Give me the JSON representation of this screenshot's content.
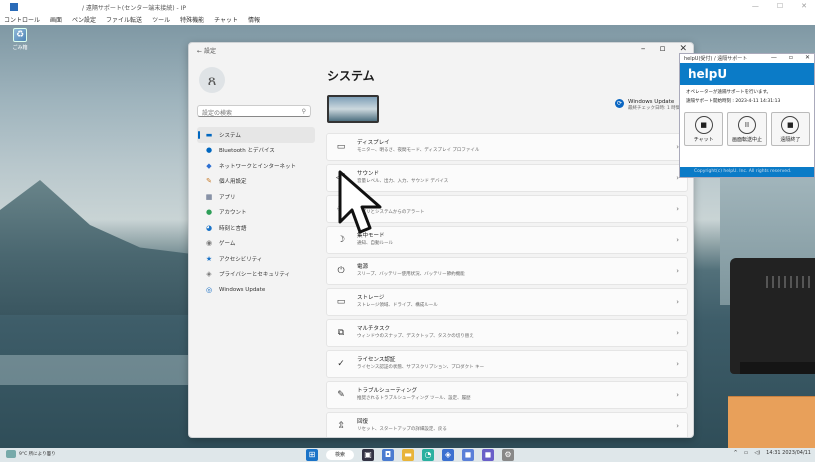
{
  "remote_window": {
    "title": "/ 遠隔サポート(センター端末接続) - IP",
    "menu": [
      "コントロール",
      "画面",
      "ペン設定",
      "ファイル転送",
      "ツール",
      "特殊機能",
      "チャット",
      "情報"
    ]
  },
  "desktop": {
    "icon_label": "ごみ箱"
  },
  "settings": {
    "back_label": "設定",
    "search_placeholder": "設定の検索",
    "page_title": "システム",
    "windows_update": {
      "title": "Windows Update",
      "subtitle": "最終チェック日時: 1 時間前"
    },
    "nav": [
      {
        "icon": "system-icon",
        "glyph": "▬",
        "label": "システム",
        "color": "#0067c0",
        "selected": true
      },
      {
        "icon": "bluetooth-icon",
        "glyph": "●",
        "label": "Bluetooth とデバイス",
        "color": "#0067c0"
      },
      {
        "icon": "network-icon",
        "glyph": "◆",
        "label": "ネットワークとインターネット",
        "color": "#2d6fd1"
      },
      {
        "icon": "personalization-icon",
        "glyph": "✎",
        "label": "個人用設定",
        "color": "#c77b2a"
      },
      {
        "icon": "apps-icon",
        "glyph": "▦",
        "label": "アプリ",
        "color": "#4a5a7a"
      },
      {
        "icon": "accounts-icon",
        "glyph": "●",
        "label": "アカウント",
        "color": "#2e9e58"
      },
      {
        "icon": "time-language-icon",
        "glyph": "◕",
        "label": "時刻と言語",
        "color": "#1a73c8"
      },
      {
        "icon": "gaming-icon",
        "glyph": "◉",
        "label": "ゲーム",
        "color": "#777"
      },
      {
        "icon": "accessibility-icon",
        "glyph": "★",
        "label": "アクセシビリティ",
        "color": "#1a73c8"
      },
      {
        "icon": "privacy-icon",
        "glyph": "◈",
        "label": "プライバシーとセキュリティ",
        "color": "#777"
      },
      {
        "icon": "windows-update-icon",
        "glyph": "◎",
        "label": "Windows Update",
        "color": "#0a66c2"
      }
    ],
    "cards": [
      {
        "icon": "display-icon",
        "glyph": "▭",
        "title": "ディスプレイ",
        "sub": "モニター、明るさ、夜間モード、ディスプレイ プロファイル"
      },
      {
        "icon": "sound-icon",
        "glyph": "◁)",
        "title": "サウンド",
        "sub": "音量レベル、出力、入力、サウンド デバイス"
      },
      {
        "icon": "notifications-icon",
        "glyph": "◌",
        "title": "通知",
        "sub": "アプリとシステムからのアラート"
      },
      {
        "icon": "focus-icon",
        "glyph": "☽",
        "title": "集中モード",
        "sub": "通知、自動ルール"
      },
      {
        "icon": "power-icon",
        "glyph": "⏻",
        "title": "電源",
        "sub": "スリープ、バッテリー使用状況、バッテリー節約機能"
      },
      {
        "icon": "storage-icon",
        "glyph": "▭",
        "title": "ストレージ",
        "sub": "ストレージ領域、ドライブ、構成ルール"
      },
      {
        "icon": "multitasking-icon",
        "glyph": "⧉",
        "title": "マルチタスク",
        "sub": "ウィンドウのスナップ、デスクトップ、タスクの切り替え"
      },
      {
        "icon": "activation-icon",
        "glyph": "✓",
        "title": "ライセンス認証",
        "sub": "ライセンス認証の状態、サブスクリプション、プロダクト キー"
      },
      {
        "icon": "troubleshoot-icon",
        "glyph": "✎",
        "title": "トラブルシューティング",
        "sub": "推奨されるトラブルシューティング ツール、設定、履歴"
      },
      {
        "icon": "recovery-icon",
        "glyph": "⇬",
        "title": "回復",
        "sub": "リセット、スタートアップの詳細設定、戻る"
      }
    ]
  },
  "helpu": {
    "title": "helpU(受付) / 遠隔サポート",
    "logo": "helpU",
    "message": "オペレーターが遠隔サポートを行います。",
    "session_info": "遠隔サポート開始時刻 : 2023-4-11 14:31:13",
    "buttons": [
      {
        "label": "チャット",
        "glyph": "■"
      },
      {
        "label": "画面転送中止",
        "glyph": "II"
      },
      {
        "label": "遠隔終了",
        "glyph": "■"
      }
    ],
    "footer": "Copyright(c) helpU. Inc. All rights reserved."
  },
  "taskbar": {
    "weather": "9°C 所により曇り",
    "search_label": "検索",
    "clock": "14:31 2023/04/11"
  }
}
